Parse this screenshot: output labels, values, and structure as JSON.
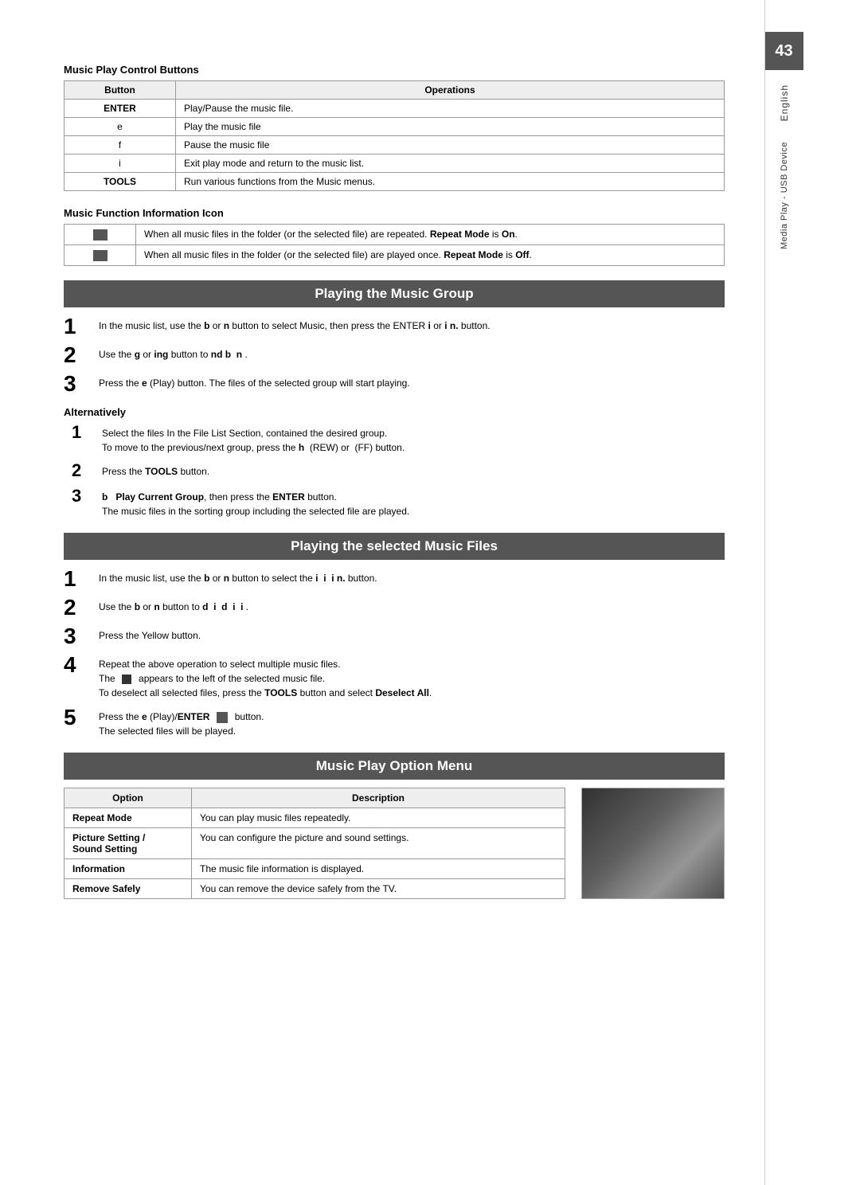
{
  "page": {
    "number": "43",
    "side_english": "English",
    "side_media": "Media Play - USB Device"
  },
  "music_play_control": {
    "title": "Music Play Control Buttons",
    "table": {
      "headers": [
        "Button",
        "Operations"
      ],
      "rows": [
        {
          "button": "ENTER",
          "operation": "Play/Pause the music file."
        },
        {
          "button": "e",
          "operation": "Play the music file"
        },
        {
          "button": "f",
          "operation": "Pause the music file"
        },
        {
          "button": "i",
          "operation": "Exit play mode and return to the music list."
        },
        {
          "button": "TOOLS",
          "operation": "Run various functions from the Music menus."
        }
      ]
    }
  },
  "music_function_info": {
    "title": "Music Function Information Icon",
    "rows": [
      {
        "icon_label": "",
        "description": "When all music files in the folder (or the selected file) are repeated. Repeat Mode is On."
      },
      {
        "icon_label": "",
        "description": "When all music files in the folder (or the selected file) are played once. Repeat Mode is Off."
      }
    ]
  },
  "playing_music_group": {
    "header": "Playing the Music Group",
    "steps": [
      {
        "num": "1",
        "text": "In the music list, use the b or n button to select Music, then press the ENTER i or i n. button."
      },
      {
        "num": "2",
        "text": "Use the g or ing button to nd b n ."
      },
      {
        "num": "3",
        "text": "Press the e (Play) button. The files of the selected group will start playing."
      }
    ]
  },
  "alternatively": {
    "title": "Alternatively",
    "steps": [
      {
        "num": "1",
        "text": "Select the files In the File List Section, contained the desired group.",
        "subtext": "To move to the previous/next group, press the h (REW) or (FF) button."
      },
      {
        "num": "2",
        "text": "Press the TOOLS button."
      },
      {
        "num": "3",
        "text": "b Play Current Group, then press the ENTER button.",
        "subtext": "The music files in the sorting group including the selected file are played."
      }
    ]
  },
  "playing_selected": {
    "header": "Playing the selected Music Files",
    "steps": [
      {
        "num": "1",
        "text": "In the music list, use the b or n button to select the i i i n. button."
      },
      {
        "num": "2",
        "text": "Use the b or n button to d i d i i ."
      },
      {
        "num": "3",
        "text": "Press the Yellow button."
      },
      {
        "num": "4",
        "text": "Repeat the above operation to select multiple music files.",
        "subtext1": "The appears to the left of the selected music file.",
        "subtext2": "To deselect all selected files, press the TOOLS button and select Deselect All."
      },
      {
        "num": "5",
        "text": "Press the e (Play)/ENTER button.",
        "subtext": "The selected files will be played."
      }
    ]
  },
  "option_menu": {
    "header": "Music Play Option Menu",
    "table": {
      "headers": [
        "Option",
        "Description"
      ],
      "rows": [
        {
          "option": "Repeat Mode",
          "description": "You can play music files repeatedly."
        },
        {
          "option": "Picture Setting / Sound Setting",
          "description": "You can configure the picture and sound settings."
        },
        {
          "option": "Information",
          "description": "The music file information is displayed."
        },
        {
          "option": "Remove Safely",
          "description": "You can remove the device safely from the TV."
        }
      ]
    }
  }
}
